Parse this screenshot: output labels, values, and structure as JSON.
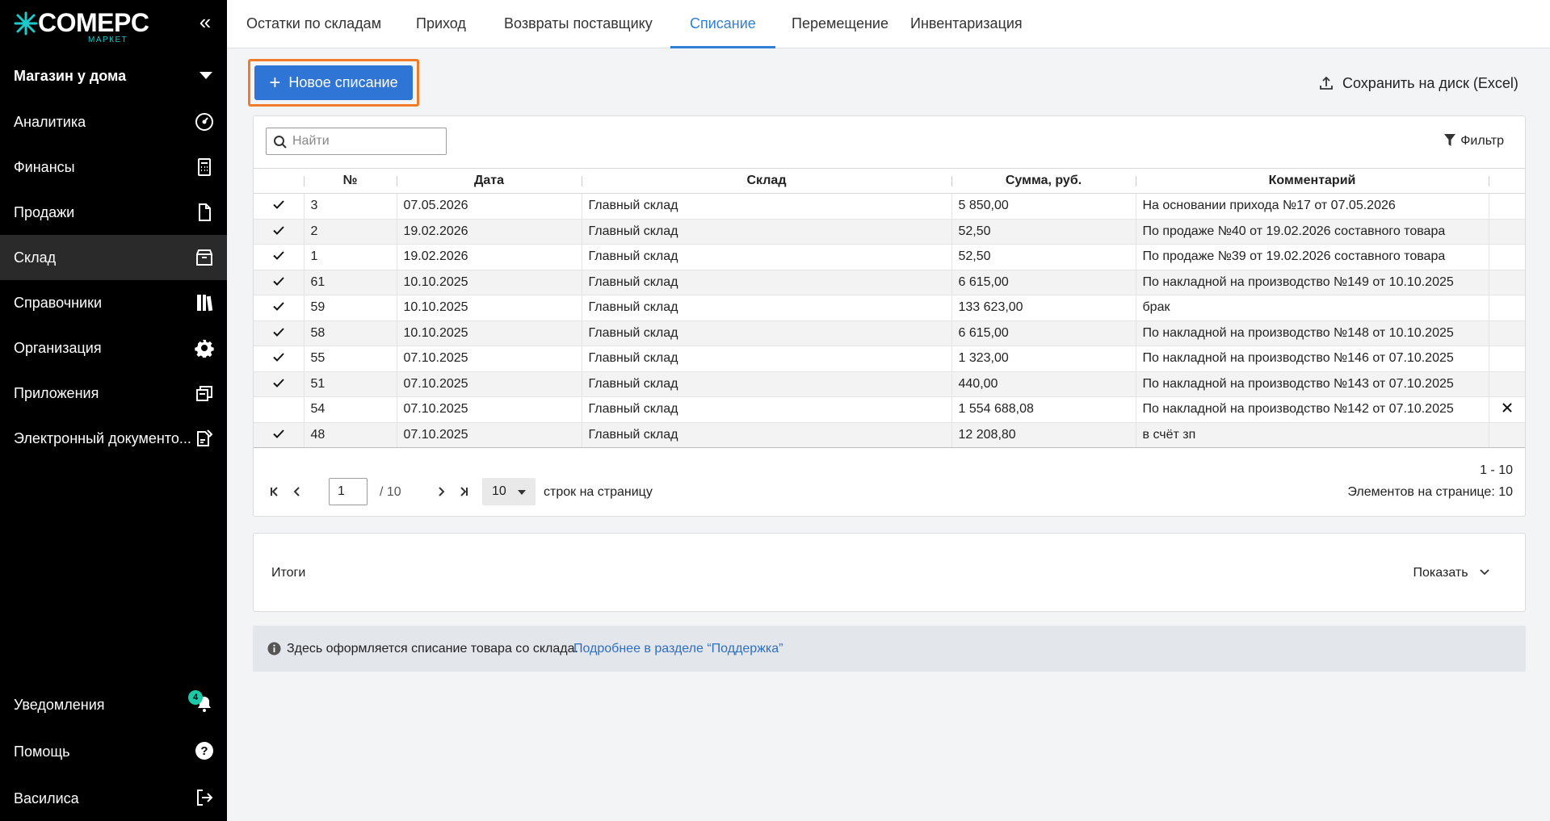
{
  "app": {
    "logo_text": "COMEPC",
    "logo_sub": "МАРКЕТ",
    "collapse_glyph": "«"
  },
  "store": {
    "name": "Магазин у дома"
  },
  "sidebar": {
    "items": [
      {
        "label": "Аналитика",
        "icon": "gauge-icon"
      },
      {
        "label": "Финансы",
        "icon": "calculator-icon"
      },
      {
        "label": "Продажи",
        "icon": "document-icon"
      },
      {
        "label": "Склад",
        "icon": "box-icon",
        "active": true
      },
      {
        "label": "Справочники",
        "icon": "books-icon"
      },
      {
        "label": "Организация",
        "icon": "gear-icon"
      },
      {
        "label": "Приложения",
        "icon": "windows-icon"
      },
      {
        "label": "Электронный документо...",
        "icon": "edoc-icon"
      }
    ],
    "bottom": [
      {
        "label": "Уведомления",
        "icon": "bell-icon",
        "badge": "4"
      },
      {
        "label": "Помощь",
        "icon": "help-icon"
      },
      {
        "label": "Василиса",
        "icon": "logout-icon"
      }
    ]
  },
  "tabs": [
    {
      "label": "Остатки по складам"
    },
    {
      "label": "Приход"
    },
    {
      "label": "Возвраты поставщику"
    },
    {
      "label": "Списание",
      "active": true
    },
    {
      "label": "Перемещение"
    },
    {
      "label": "Инвентаризация"
    }
  ],
  "toolbar": {
    "new_label": "Новое списание",
    "export_label": "Сохранить на диск (Excel)"
  },
  "search": {
    "placeholder": "Найти",
    "value": ""
  },
  "filter_label": "Фильтр",
  "table": {
    "columns": [
      "",
      "№",
      "Дата",
      "Склад",
      "Сумма, руб.",
      "Комментарий",
      ""
    ],
    "rows": [
      {
        "checked": true,
        "num": "3",
        "date": "07.05.2026",
        "warehouse": "Главный склад",
        "sum": "5 850,00",
        "comment": "На основании прихода №17 от 07.05.2026",
        "deletable": false
      },
      {
        "checked": true,
        "num": "2",
        "date": "19.02.2026",
        "warehouse": "Главный склад",
        "sum": "52,50",
        "comment": "По продаже №40 от 19.02.2026 составного товара",
        "deletable": false
      },
      {
        "checked": true,
        "num": "1",
        "date": "19.02.2026",
        "warehouse": "Главный склад",
        "sum": "52,50",
        "comment": "По продаже №39 от 19.02.2026 составного товара",
        "deletable": false
      },
      {
        "checked": true,
        "num": "61",
        "date": "10.10.2025",
        "warehouse": "Главный склад",
        "sum": "6 615,00",
        "comment": "По накладной на производство №149 от 10.10.2025",
        "deletable": false
      },
      {
        "checked": true,
        "num": "59",
        "date": "10.10.2025",
        "warehouse": "Главный склад",
        "sum": "133 623,00",
        "comment": "брак",
        "deletable": false
      },
      {
        "checked": true,
        "num": "58",
        "date": "10.10.2025",
        "warehouse": "Главный склад",
        "sum": "6 615,00",
        "comment": "По накладной на производство №148 от 10.10.2025",
        "deletable": false
      },
      {
        "checked": true,
        "num": "55",
        "date": "07.10.2025",
        "warehouse": "Главный склад",
        "sum": "1 323,00",
        "comment": "По накладной на производство №146 от 07.10.2025",
        "deletable": false
      },
      {
        "checked": true,
        "num": "51",
        "date": "07.10.2025",
        "warehouse": "Главный склад",
        "sum": "440,00",
        "comment": "По накладной на производство №143 от 07.10.2025",
        "deletable": false
      },
      {
        "checked": false,
        "num": "54",
        "date": "07.10.2025",
        "warehouse": "Главный склад",
        "sum": "1 554 688,08",
        "comment": "По накладной на производство №142 от 07.10.2025",
        "deletable": true
      },
      {
        "checked": true,
        "num": "48",
        "date": "07.10.2025",
        "warehouse": "Главный склад",
        "sum": "12 208,80",
        "comment": "в счёт зп",
        "deletable": false
      }
    ]
  },
  "pager": {
    "page": "1",
    "of_label": "/  10",
    "page_size": "10",
    "page_size_label": "строк на страницу",
    "range": "1 - 10",
    "per_page": "Элементов на странице: 10"
  },
  "totals": {
    "title": "Итоги",
    "show_label": "Показать"
  },
  "info": {
    "text": "Здесь оформляется списание товара со склада.",
    "link": "Подробнее в разделе “Поддержка”"
  },
  "colors": {
    "accent": "#2f75d6",
    "highlight": "#f07b2a",
    "sidebar_bg": "#000000",
    "brand_teal": "#1ec9c9"
  }
}
